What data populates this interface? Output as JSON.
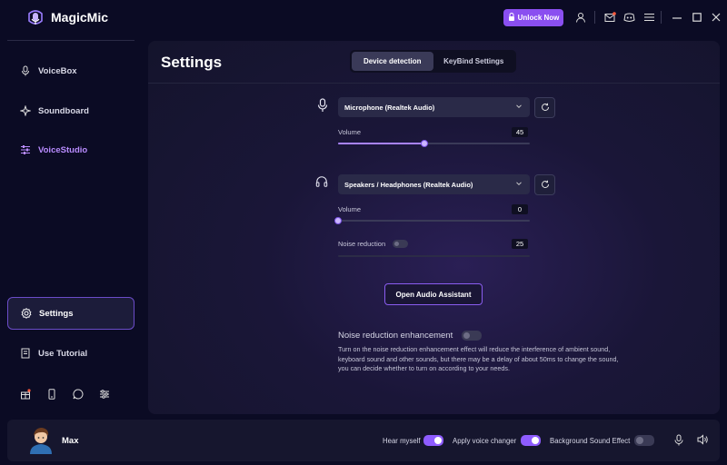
{
  "app": {
    "name": "MagicMic",
    "unlock_label": "Unlock Now"
  },
  "sidebar": {
    "items": [
      {
        "label": "VoiceBox",
        "icon": "microphone-icon"
      },
      {
        "label": "Soundboard",
        "icon": "sparkle-icon"
      },
      {
        "label": "VoiceStudio",
        "icon": "sliders-icon"
      },
      {
        "label": "Settings",
        "icon": "gear-icon"
      },
      {
        "label": "Use Tutorial",
        "icon": "book-icon"
      }
    ],
    "bottom_icons": [
      "gift-icon",
      "phone-icon",
      "whatsapp-icon",
      "filter-icon"
    ]
  },
  "settings": {
    "title": "Settings",
    "tabs": [
      {
        "label": "Device detection",
        "active": true
      },
      {
        "label": "KeyBind Settings",
        "active": false
      }
    ],
    "microphone": {
      "device": "Microphone (Realtek Audio)",
      "volume_label": "Volume",
      "volume": 45
    },
    "speakers": {
      "device": "Speakers / Headphones (Realtek Audio)",
      "volume_label": "Volume",
      "volume": 0,
      "noise_label": "Noise reduction",
      "noise_value": 25,
      "noise_enabled": false
    },
    "assistant_button": "Open Audio Assistant",
    "enhancement": {
      "label": "Noise reduction enhancement",
      "enabled": false,
      "description": "Turn on the noise reduction enhancement effect will reduce the interference of ambient sound, keyboard sound and other sounds, but there may be a delay of about 50ms to change the sound, you can decide whether to turn on according to your needs."
    }
  },
  "bottombar": {
    "user": "Max",
    "hear_myself": {
      "label": "Hear myself",
      "on": true
    },
    "apply_voice_changer": {
      "label": "Apply voice changer",
      "on": true
    },
    "background_sound_effect": {
      "label": "Background Sound Effect",
      "on": false
    }
  },
  "colors": {
    "accent": "#8a4ff0",
    "background": "#0b0b24",
    "panel": "#1a1638"
  }
}
